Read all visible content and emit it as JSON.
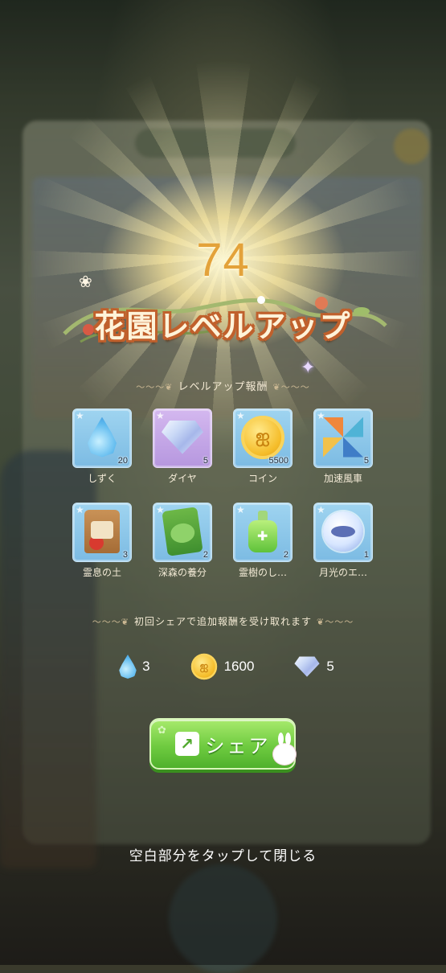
{
  "level": "74",
  "title": "花園レベルアップ",
  "rewards_header": "レベルアップ報酬",
  "rewards": [
    {
      "name": "しずく",
      "qty": "20",
      "icon": "water-drop-icon"
    },
    {
      "name": "ダイヤ",
      "qty": "5",
      "icon": "diamond-icon"
    },
    {
      "name": "コイン",
      "qty": "5500",
      "icon": "coin-icon"
    },
    {
      "name": "加速風車",
      "qty": "5",
      "icon": "pinwheel-icon"
    },
    {
      "name": "霊息の土",
      "qty": "3",
      "icon": "soil-bag-icon"
    },
    {
      "name": "深森の養分",
      "qty": "2",
      "icon": "nutrient-bag-icon"
    },
    {
      "name": "霊樹のし…",
      "qty": "2",
      "icon": "potion-bottle-icon"
    },
    {
      "name": "月光のエ…",
      "qty": "1",
      "icon": "moonlight-orb-icon"
    }
  ],
  "share_bonus_header": "初回シェアで追加報酬を受け取れます",
  "share_bonus": [
    {
      "icon": "water-drop-icon",
      "value": "3"
    },
    {
      "icon": "coin-icon",
      "value": "1600"
    },
    {
      "icon": "diamond-icon",
      "value": "5"
    }
  ],
  "share_button_label": "シェア",
  "close_hint": "空白部分をタップして閉じる",
  "colors": {
    "level_number": "#e3a23a",
    "title_outline": "#c0602c",
    "share_button": "#6fcb40"
  }
}
